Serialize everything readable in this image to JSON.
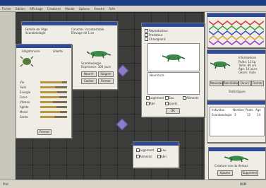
{
  "app": {
    "menu": [
      "Fichier",
      "Edition",
      "Affichage",
      "Creatures",
      "Monde",
      "Options",
      "Fenetre",
      "Aide"
    ]
  },
  "status": {
    "left": "Pret",
    "right": "NUM"
  },
  "creature_window": {
    "field1": "Famille de l'Age",
    "field2": "Scarabeologie",
    "field3": "Caracter. incontestable",
    "field4": "Elevage de 1 an",
    "species": "Scarabeologie",
    "age": "Esperance: 300 jours",
    "buttons": [
      "Nourrir",
      "Soigner",
      "Cacher",
      "Fermer"
    ]
  },
  "stats_window": {
    "title": "Alligatorvore",
    "subtitle": "Liberte",
    "rows": [
      {
        "label": "Vie",
        "value": 0.82
      },
      {
        "label": "Faim",
        "value": 0.55
      },
      {
        "label": "Energie",
        "value": 0.62
      },
      {
        "label": "Force",
        "value": 0.7
      },
      {
        "label": "Vitesse",
        "value": 0.48
      },
      {
        "label": "Agilite",
        "value": 0.6
      },
      {
        "label": "Moral",
        "value": 0.74
      },
      {
        "label": "Sante",
        "value": 0.53
      }
    ],
    "ok": "Fermer"
  },
  "inventory_window": {
    "options": [
      "Reproducteur",
      "Predateur",
      "Charognard"
    ],
    "list_header": "Nourriture",
    "checks": [
      "Logement",
      "Eau",
      "Aliments",
      "Abri",
      "Jouets"
    ],
    "ok": "OK"
  },
  "graph_window": {
    "colors": [
      "#d63b3b",
      "#3fa73f",
      "#3b55c9",
      "#d6a33b",
      "#9c3bc9"
    ]
  },
  "info_window": {
    "title": "Informations",
    "lines": [
      "Poids: 12 kg",
      "Taille: 80 cm",
      "Age: 14 jours",
      "Genre: male"
    ],
    "buttons": [
      "Nouveau",
      "Reinitialiser",
      "Ouvrir",
      "Fermer"
    ],
    "foot": "Statistiques"
  },
  "table_window": {
    "headers": [
      "Individus",
      "Nombre",
      "Poids",
      "Age"
    ],
    "row": [
      "Scarabeologie",
      "3",
      "12",
      "14"
    ]
  },
  "small_window": {
    "checks": [
      "Logement",
      "Eau",
      "Aliments",
      "Abri"
    ]
  },
  "preview_window": {
    "caption": "Creature vue du dessus",
    "buttons": [
      "Ajouter",
      "Supprimer"
    ]
  }
}
